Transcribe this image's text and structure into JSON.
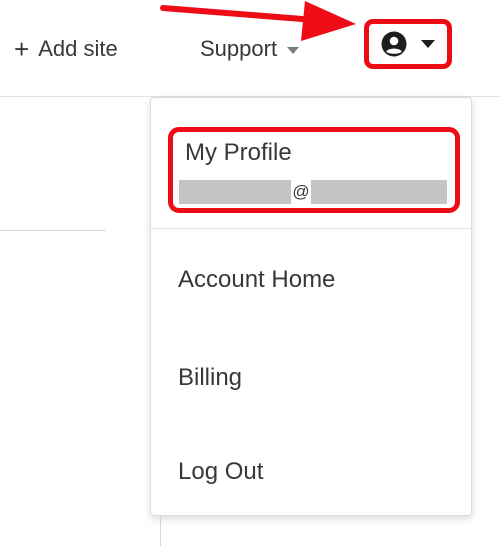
{
  "header": {
    "add_site_icon": "plus-icon",
    "add_site_label": "Add site",
    "support_label": "Support",
    "support_icon": "caret-down-icon",
    "user_icon": "user-circle-icon",
    "user_caret_icon": "caret-down-icon"
  },
  "menu": {
    "profile": {
      "label": "My Profile",
      "email_at": "@"
    },
    "items": [
      {
        "label": "Account Home"
      },
      {
        "label": "Billing"
      },
      {
        "label": "Log Out"
      }
    ]
  },
  "colors": {
    "highlight": "#ee0c17",
    "text": "#36393a",
    "redaction": "#c4c4c4"
  }
}
